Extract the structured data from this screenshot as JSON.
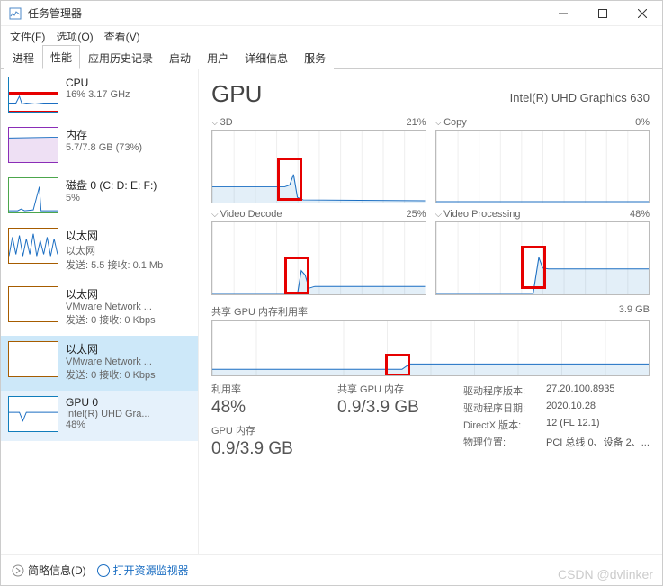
{
  "window": {
    "title": "任务管理器"
  },
  "menu": {
    "file": "文件(F)",
    "options": "选项(O)",
    "view": "查看(V)"
  },
  "tabs": {
    "processes": "进程",
    "performance": "性能",
    "app_history": "应用历史记录",
    "startup": "启动",
    "users": "用户",
    "details": "详细信息",
    "services": "服务"
  },
  "sidebar": {
    "cpu": {
      "name": "CPU",
      "sub": "16% 3.17 GHz"
    },
    "memory": {
      "name": "内存",
      "sub": "5.7/7.8 GB (73%)"
    },
    "disk": {
      "name": "磁盘 0 (C: D: E: F:)",
      "sub": "5%"
    },
    "eth0": {
      "name": "以太网",
      "sub1": "以太网",
      "sub2": "发送: 5.5 接收: 0.1 Mb"
    },
    "eth1": {
      "name": "以太网",
      "sub1": "VMware Network ...",
      "sub2": "发送: 0 接收: 0 Kbps"
    },
    "eth2": {
      "name": "以太网",
      "sub1": "VMware Network ...",
      "sub2": "发送: 0 接收: 0 Kbps"
    },
    "gpu": {
      "name": "GPU 0",
      "sub1": "Intel(R) UHD Gra...",
      "sub2": "48%"
    }
  },
  "main": {
    "title": "GPU",
    "device": "Intel(R) UHD Graphics 630",
    "engines": {
      "e0": {
        "name": "3D",
        "pct": "21%"
      },
      "e1": {
        "name": "Copy",
        "pct": "0%"
      },
      "e2": {
        "name": "Video Decode",
        "pct": "25%"
      },
      "e3": {
        "name": "Video Processing",
        "pct": "48%"
      }
    },
    "shared_mem_label": "共享 GPU 内存利用率",
    "shared_mem_max": "3.9 GB",
    "stats": {
      "util_label": "利用率",
      "util_val": "48%",
      "shared_label": "共享 GPU 内存",
      "shared_val": "0.9/3.9 GB",
      "gpu_mem_label": "GPU 内存",
      "gpu_mem_val": "0.9/3.9 GB"
    },
    "details": {
      "driver_ver_k": "驱动程序版本:",
      "driver_ver_v": "27.20.100.8935",
      "driver_date_k": "驱动程序日期:",
      "driver_date_v": "2020.10.28",
      "dx_k": "DirectX 版本:",
      "dx_v": "12 (FL 12.1)",
      "loc_k": "物理位置:",
      "loc_v": "PCI 总线 0、设备 2、..."
    }
  },
  "bottom": {
    "less": "简略信息(D)",
    "resmon": "打开资源监视器"
  },
  "watermark": "CSDN @dvlinker",
  "chart_data": [
    {
      "type": "line",
      "title": "3D",
      "ylim": [
        0,
        100
      ],
      "values": [
        22,
        22,
        22,
        22,
        22,
        22,
        22,
        24,
        15,
        3,
        3,
        3,
        3,
        3,
        3,
        3,
        3,
        3,
        3,
        3
      ]
    },
    {
      "type": "line",
      "title": "Copy",
      "ylim": [
        0,
        100
      ],
      "values": [
        0,
        0,
        0,
        0,
        0,
        0,
        0,
        0,
        0,
        0,
        0,
        0,
        0,
        0,
        0,
        0,
        0,
        0,
        0,
        0
      ]
    },
    {
      "type": "line",
      "title": "Video Decode",
      "ylim": [
        0,
        100
      ],
      "values": [
        0,
        0,
        0,
        0,
        0,
        0,
        0,
        0,
        30,
        25,
        10,
        10,
        10,
        10,
        10,
        10,
        10,
        10,
        10,
        10
      ]
    },
    {
      "type": "line",
      "title": "Video Processing",
      "ylim": [
        0,
        100
      ],
      "values": [
        0,
        0,
        0,
        0,
        0,
        0,
        0,
        0,
        0,
        48,
        35,
        35,
        35,
        35,
        35,
        35,
        35,
        35,
        35,
        35
      ]
    },
    {
      "type": "line",
      "title": "Shared GPU Memory",
      "ylim": [
        0,
        3.9
      ],
      "values": [
        0.5,
        0.5,
        0.5,
        0.5,
        0.5,
        0.5,
        0.5,
        0.5,
        0.5,
        0.9,
        0.9,
        0.9,
        0.9,
        0.9,
        0.9,
        0.9,
        0.9,
        0.9,
        0.9,
        0.9
      ]
    }
  ]
}
